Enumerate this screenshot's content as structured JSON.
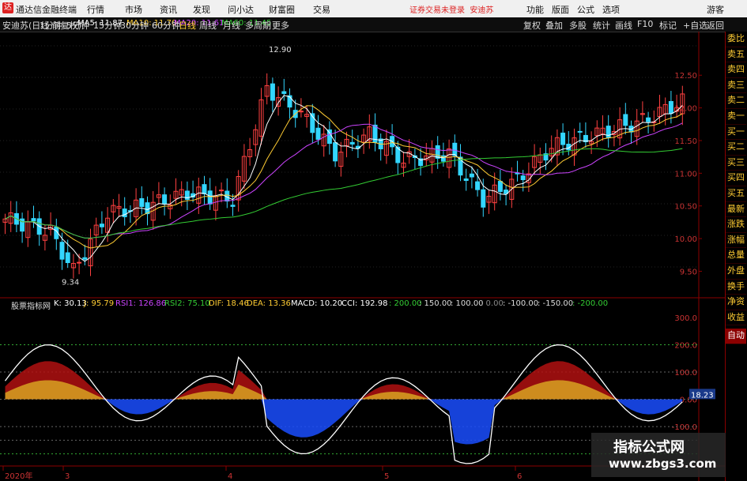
{
  "window": {
    "app_title": "通达信金融终端",
    "menu": [
      "行情",
      "市场",
      "资讯",
      "发现",
      "问小达",
      "财富圈",
      "交易"
    ],
    "status": "证券交易未登录",
    "stock": "安迪苏",
    "right_buttons": [
      "功能",
      "版面",
      "公式",
      "选项",
      "游客"
    ]
  },
  "toolbar": {
    "stock_label": "安迪苏(日线 前复权)",
    "ma5": "MA5: 11.87",
    "ma10": "MA10: 11.70",
    "ma20": "MA20: 11.61",
    "ma60": "MA60: 11.45",
    "periods": [
      "1分钟",
      "1分钟",
      "5分钟",
      "15分钟",
      "30分钟",
      "60分钟",
      "日线",
      "周线",
      "月线",
      "多周期",
      "更多"
    ],
    "buttons": [
      "复权",
      "叠加",
      "多股",
      "统计",
      "画线",
      "F10",
      "标记",
      "+自选",
      "返回"
    ]
  },
  "colors": {
    "up": "#ff4040",
    "down": "#33d6ff",
    "ma5": "#ffffff",
    "ma10": "#ffcc33",
    "ma20": "#cc44ff",
    "ma60": "#33cc33",
    "bg": "#000000",
    "axis": "#8b0000"
  },
  "price_chart": {
    "high_label": "12.90",
    "low_label": "9.34",
    "y_ticks": [
      "12.50",
      "12.00",
      "11.50",
      "11.00",
      "10.50",
      "10.00",
      "9.50"
    ]
  },
  "indicator": {
    "name": "股票指标网",
    "k": "K: 30.13",
    "j": "J: 95.79",
    "rsi1": "RSI1: 126.86",
    "rsi2": "RSI2: 75.10",
    "dif": "DIF: 18.46",
    "dea": "DEA: 13.36",
    "macd": "MACD: 10.20",
    "cci": "CCI: 192.98",
    "levels": [
      ": 200.00",
      ": 150.00",
      ": 100.00",
      ": 0.00",
      ": -100.00",
      ": -150.00",
      ": -200.00"
    ],
    "y_ticks": [
      "300.0",
      "200.0",
      "100.0",
      "0.00",
      "-100.0"
    ],
    "current_value": "18.23"
  },
  "x_axis": {
    "labels": [
      "2020年",
      "3",
      "4",
      "5",
      "6"
    ]
  },
  "sidebar": {
    "items": [
      "委比",
      "卖五",
      "卖四",
      "卖三",
      "卖二",
      "卖一",
      "买一",
      "买二",
      "买三",
      "买四",
      "买五",
      "最新",
      "涨跌",
      "涨幅",
      "总量",
      "外盘",
      "换手",
      "净资",
      "收益"
    ],
    "auto_label": "自动"
  },
  "watermark": {
    "line1": "指标公式网",
    "line2": "www.zbgs3.com"
  }
}
